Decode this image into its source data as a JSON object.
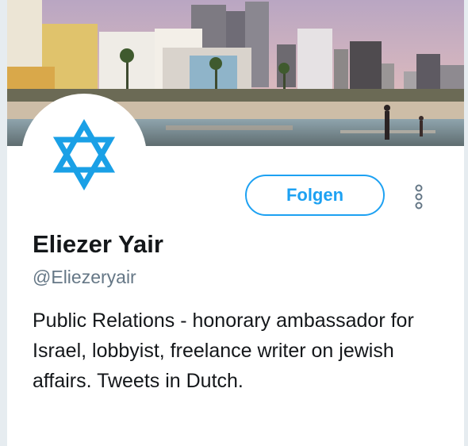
{
  "profile": {
    "name": "Eliezer Yair",
    "handle": "@Eliezeryair",
    "bio": "Public Relations - honorary ambassador for Israel, lobbyist, freelance writer on jewish affairs. Tweets in Dutch."
  },
  "actions": {
    "follow_label": "Folgen"
  },
  "icons": {
    "avatar": "star-of-david-icon",
    "more": "more-vertical-icon"
  },
  "colors": {
    "accent": "#1da1f2",
    "star": "#1aa0e6",
    "name_text": "#14171a",
    "secondary_text": "#657786"
  }
}
